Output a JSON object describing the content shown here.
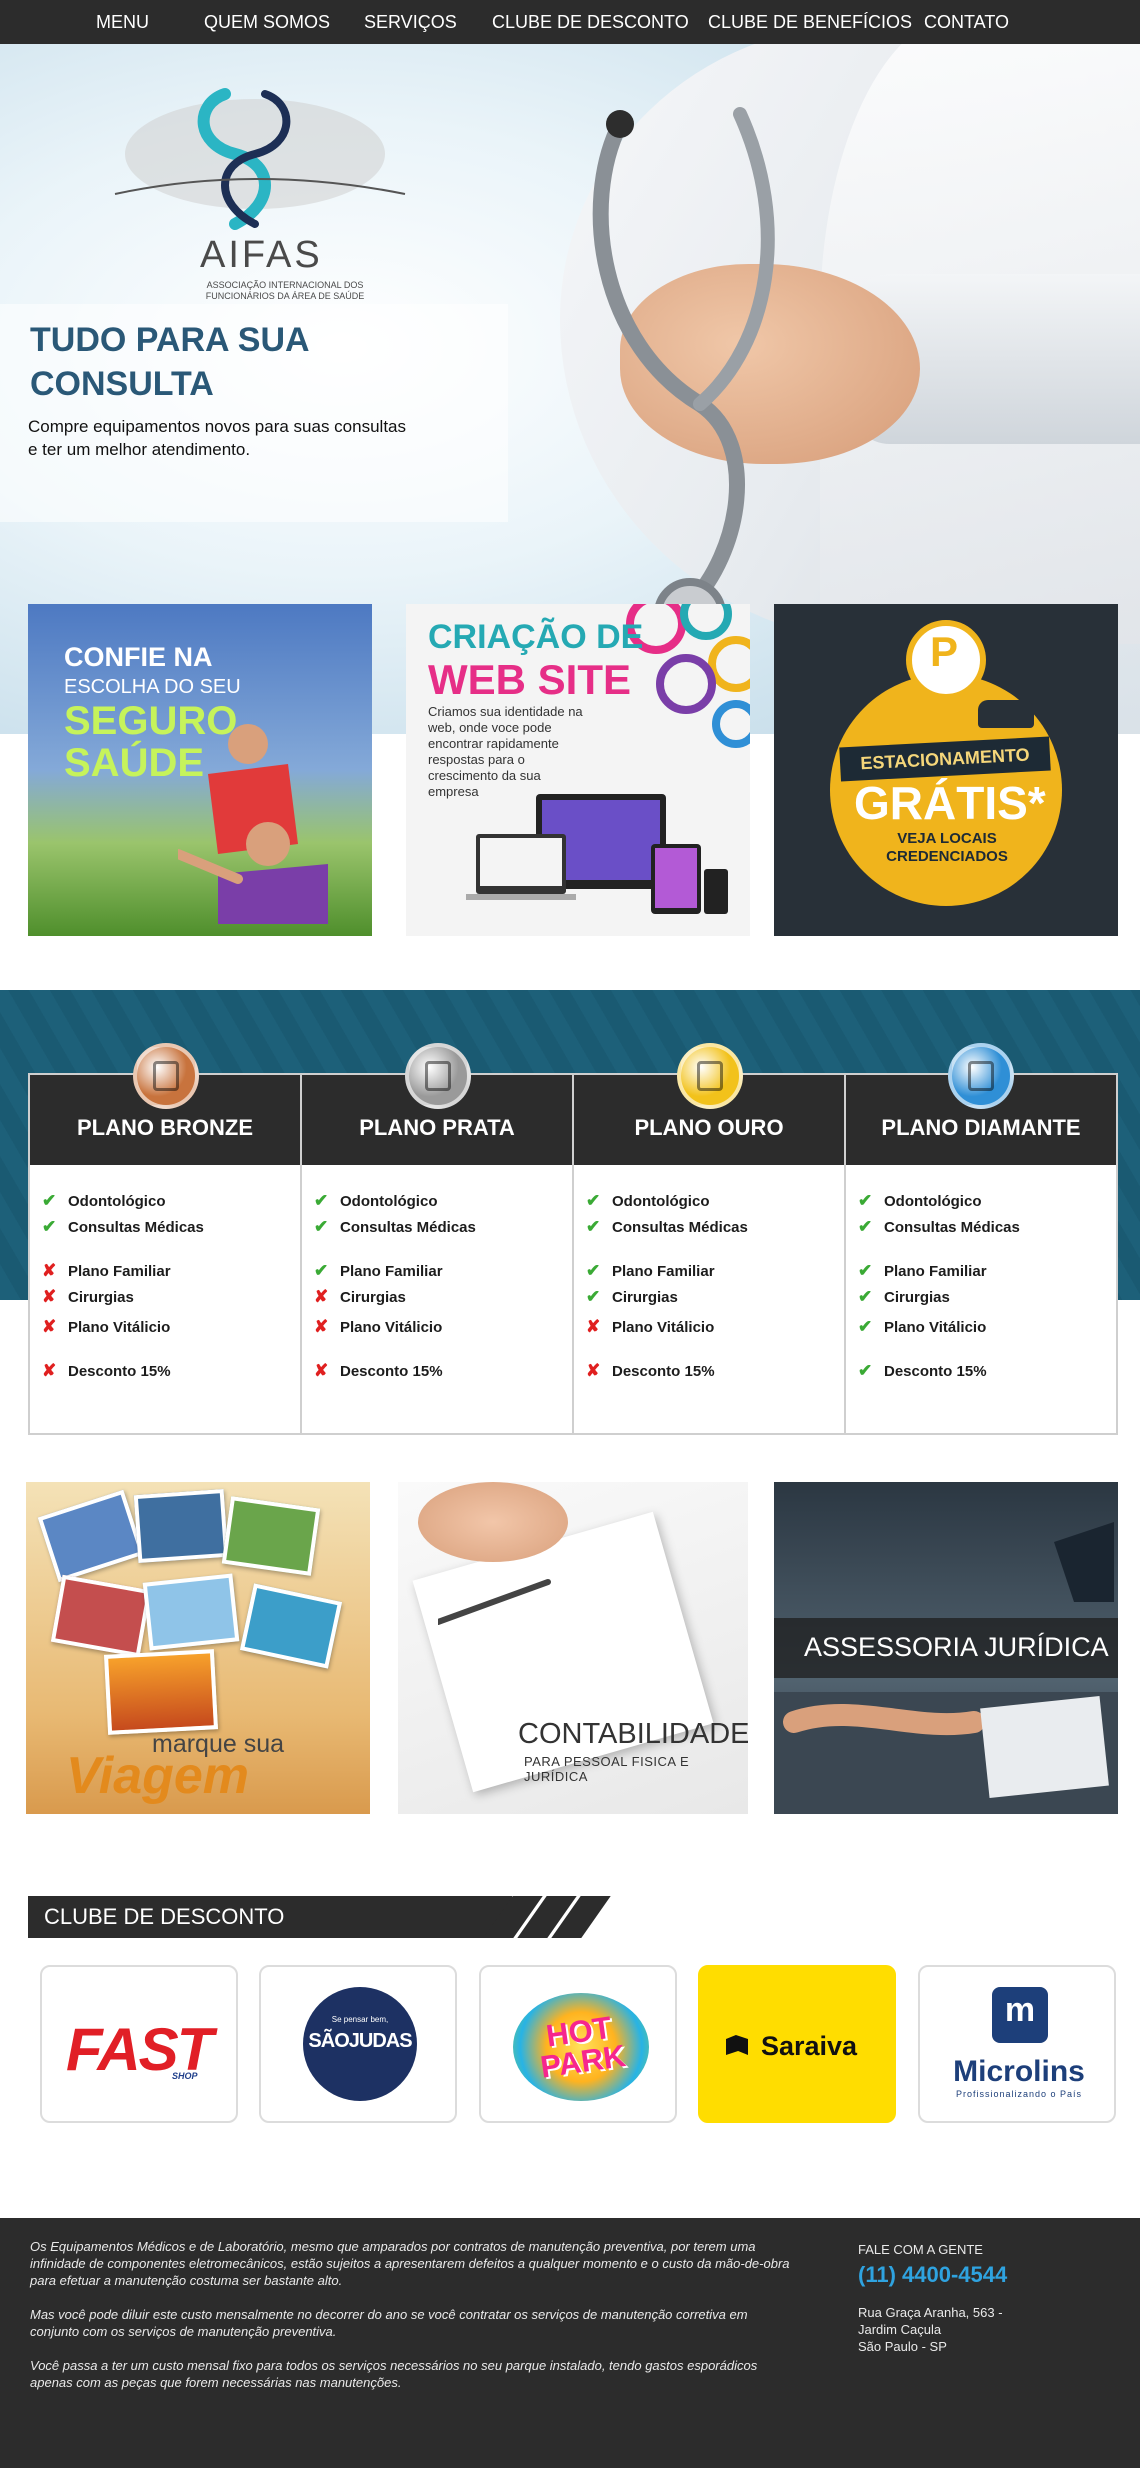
{
  "nav": {
    "items": [
      "MENU",
      "QUEM SOMOS",
      "SERVIÇOS",
      "CLUBE DE DESCONTO",
      "CLUBE DE BENEFÍCIOS",
      "CONTATO"
    ]
  },
  "logo": {
    "name": "AIFAS",
    "subtitle": "ASSOCIAÇÃO INTERNACIONAL DOS FUNCIONÁRIOS DA ÁREA DE SAÚDE"
  },
  "hero": {
    "title": "TUDO PARA SUA CONSULTA",
    "text": "Compre equipamentos novos para suas consultas\n e ter um melhor atendimento."
  },
  "banners": {
    "health": {
      "line1": "CONFIE NA",
      "line2": "ESCOLHA DO SEU",
      "line3": "SEGURO",
      "line4": "SAÚDE"
    },
    "web": {
      "line1": "CRIAÇÃO DE",
      "line2": "WEB SITE",
      "text": "Criamos sua identidade na web, onde voce pode encontrar rapidamente respostas para o crescimento da sua empresa"
    },
    "parking": {
      "pin": "P",
      "tag": "ESTACIONAMENTO",
      "big": "GRÁTIS*",
      "small": "VEJA LOCAIS CREDENCIADOS"
    }
  },
  "plans": {
    "items": [
      {
        "name": "PLANO BRONZE",
        "medal_color": "#c8733d"
      },
      {
        "name": "PLANO PRATA",
        "medal_color": "#9a9a9a"
      },
      {
        "name": "PLANO OURO",
        "medal_color": "#f2c21b"
      },
      {
        "name": "PLANO DIAMANTE",
        "medal_color": "#2f8fd6"
      }
    ],
    "features": [
      "Odontológico",
      "Consultas Médicas",
      "Plano Familiar",
      "Cirurgias",
      "Plano Vitálicio",
      "Desconto 15%"
    ],
    "included": [
      [
        true,
        true,
        false,
        false,
        false,
        false
      ],
      [
        true,
        true,
        true,
        false,
        false,
        false
      ],
      [
        true,
        true,
        true,
        true,
        false,
        false
      ],
      [
        true,
        true,
        true,
        true,
        true,
        true
      ]
    ],
    "check_symbol": "✔",
    "cross_symbol": "✘"
  },
  "services": {
    "travel": {
      "line1": "marque sua",
      "line2": "Viagem"
    },
    "accounting": {
      "line1": "CONTABILIDADE",
      "line2": "PARA PESSOAL FISICA E JURÍDICA"
    },
    "legal": {
      "line1": "ASSESSORIA JURÍDICA"
    }
  },
  "club": {
    "title": "CLUBE DE DESCONTO",
    "brands": {
      "fast": {
        "name": "FAST",
        "sub": "SHOP"
      },
      "saojudas": {
        "name": "SÃOJUDAS",
        "tagline": "Se pensar bem,"
      },
      "hotpark": {
        "name": "HOT PARK"
      },
      "saraiva": {
        "name": "Saraiva"
      },
      "microlins": {
        "name": "Microlins",
        "sub": "Profissionalizando o País",
        "icon": "m"
      }
    }
  },
  "footer": {
    "paragraphs": [
      "Os Equipamentos Médicos e de Laboratório, mesmo que amparados por contratos de manutenção preventiva, por terem uma infinidade de componentes eletromecânicos, estão sujeitos a apresentarem defeitos a qualquer momento e o custo da mão-de-obra para efetuar a manutenção costuma ser bastante alto.",
      "Mas você pode diluir este custo mensalmente no decorrer do ano se você contratar os serviços de manutenção corretiva em conjunto com os serviços de manutenção preventiva.",
      "Você passa a ter um custo mensal fixo para todos os serviços necessários no seu parque instalado, tendo gastos esporádicos apenas com as peças que forem necessárias nas manutenções."
    ],
    "contact_title": "FALE COM A GENTE",
    "phone": "(11) 4400-4544",
    "address_line1": "Rua Graça Aranha, 563 - Jardim Caçula",
    "address_line2": "São Paulo - SP"
  }
}
